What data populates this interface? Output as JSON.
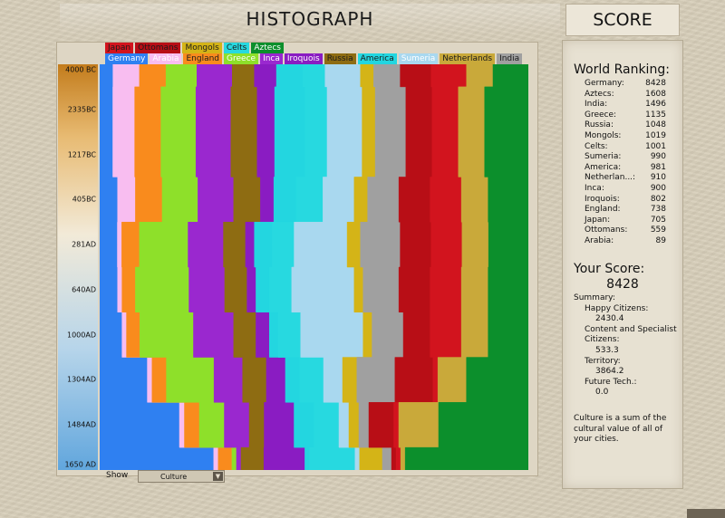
{
  "header": {
    "title": "HISTOGRAPH",
    "score_tab": "SCORE"
  },
  "legend": {
    "row1": [
      {
        "label": "Japan",
        "color": "#d2141e",
        "text": "#1b1b1b"
      },
      {
        "label": "Ottomans",
        "color": "#b80e16",
        "text": "#1b1b1b"
      },
      {
        "label": "Mongols",
        "color": "#d4b417",
        "text": "#1b1b1b"
      },
      {
        "label": "Celts",
        "color": "#27d9e0",
        "text": "#1b1b1b"
      },
      {
        "label": "Aztecs",
        "color": "#0c8f2c",
        "text": "#ffffff"
      }
    ],
    "row2": [
      {
        "label": "Germany",
        "color": "#2f80f1",
        "text": "#ffffff"
      },
      {
        "label": "Arabia",
        "color": "#f8bdf0",
        "text": "#ffffff"
      },
      {
        "label": "England",
        "color": "#f98b1d",
        "text": "#1b1b1b"
      },
      {
        "label": "Greece",
        "color": "#8ee02a",
        "text": "#ffffff"
      },
      {
        "label": "Inca",
        "color": "#9a28cf",
        "text": "#ffffff"
      },
      {
        "label": "Iroquois",
        "color": "#8a1cc2",
        "text": "#ffffff"
      },
      {
        "label": "Russia",
        "color": "#8e6c12",
        "text": "#1b1b1b"
      },
      {
        "label": "America",
        "color": "#23d6e0",
        "text": "#1b1b1b"
      },
      {
        "label": "Sumeria",
        "color": "#a9d8ef",
        "text": "#ffffff"
      },
      {
        "label": "Netherlands",
        "color": "#c9a93a",
        "text": "#1b1b1b"
      },
      {
        "label": "India",
        "color": "#a0a0a0",
        "text": "#1b1b1b"
      }
    ]
  },
  "y_axis_ticks": [
    "4000 BC",
    "2335BC",
    "1217BC",
    "405BC",
    "281AD",
    "640AD",
    "1000AD",
    "1304AD",
    "1484AD",
    "1650 AD"
  ],
  "chart_data": {
    "type": "area",
    "stacked": true,
    "normalized": true,
    "x": [
      "4000 BC",
      "2335BC",
      "1217BC",
      "405BC",
      "281AD",
      "640AD",
      "1000AD",
      "1304AD",
      "1484AD",
      "1650 AD"
    ],
    "series": [
      {
        "name": "Germany",
        "color": "#2f80f1",
        "values": [
          3,
          3,
          3,
          4,
          4,
          4,
          5,
          10,
          16,
          25
        ]
      },
      {
        "name": "Arabia",
        "color": "#f8bdf0",
        "values": [
          6,
          5,
          5,
          4,
          1,
          1,
          1,
          1,
          1,
          1
        ]
      },
      {
        "name": "England",
        "color": "#f98b1d",
        "values": [
          6,
          6,
          6,
          6,
          4,
          3,
          3,
          3,
          3,
          3
        ]
      },
      {
        "name": "Greece",
        "color": "#8ee02a",
        "values": [
          7,
          8,
          8,
          8,
          11,
          12,
          12,
          10,
          5,
          1
        ]
      },
      {
        "name": "Inca",
        "color": "#9a28cf",
        "values": [
          8,
          8,
          8,
          8,
          8,
          8,
          9,
          6,
          5,
          1
        ]
      },
      {
        "name": "Russia",
        "color": "#8e6c12",
        "values": [
          5,
          6,
          6,
          6,
          5,
          5,
          5,
          5,
          3,
          5
        ]
      },
      {
        "name": "Iroquois",
        "color": "#8a1cc2",
        "values": [
          5,
          4,
          4,
          3,
          2,
          2,
          3,
          4,
          6,
          9
        ]
      },
      {
        "name": "America",
        "color": "#23d6e0",
        "values": [
          6,
          7,
          7,
          5,
          4,
          3,
          2,
          3,
          4,
          1
        ]
      },
      {
        "name": "Celts",
        "color": "#27d9e0",
        "values": [
          5,
          5,
          5,
          6,
          5,
          5,
          5,
          5,
          5,
          10
        ]
      },
      {
        "name": "Sumeria",
        "color": "#a9d8ef",
        "values": [
          8,
          8,
          8,
          7,
          12,
          14,
          14,
          4,
          2,
          1
        ]
      },
      {
        "name": "Mongols",
        "color": "#d4b417",
        "values": [
          3,
          3,
          3,
          3,
          3,
          2,
          2,
          3,
          2,
          5
        ]
      },
      {
        "name": "India",
        "color": "#a0a0a0",
        "values": [
          6,
          7,
          7,
          7,
          9,
          8,
          7,
          8,
          2,
          2
        ]
      },
      {
        "name": "Ottomans",
        "color": "#b80e16",
        "values": [
          7,
          6,
          6,
          7,
          7,
          7,
          6,
          8,
          5,
          1
        ]
      },
      {
        "name": "Japan",
        "color": "#d2141e",
        "values": [
          8,
          6,
          6,
          7,
          7,
          7,
          7,
          1,
          1,
          1
        ]
      },
      {
        "name": "Netherlands",
        "color": "#c9a93a",
        "values": [
          6,
          6,
          6,
          6,
          6,
          6,
          6,
          6,
          8,
          1
        ]
      },
      {
        "name": "Aztecs",
        "color": "#0c8f2c",
        "values": [
          8,
          10,
          10,
          9,
          9,
          9,
          9,
          13,
          18,
          27
        ]
      }
    ],
    "ylabel": "",
    "xlabel": ""
  },
  "show": {
    "label": "Show",
    "value": "Culture"
  },
  "score_panel": {
    "world_ranking_title": "World Ranking:",
    "rankings": [
      {
        "name": "Germany:",
        "score": "8428"
      },
      {
        "name": "Aztecs:",
        "score": "1608"
      },
      {
        "name": "India:",
        "score": "1496"
      },
      {
        "name": "Greece:",
        "score": "1135"
      },
      {
        "name": "Russia:",
        "score": "1048"
      },
      {
        "name": "Mongols:",
        "score": "1019"
      },
      {
        "name": "Celts:",
        "score": "1001"
      },
      {
        "name": "Sumeria:",
        "score": "990"
      },
      {
        "name": "America:",
        "score": "981"
      },
      {
        "name": "Netherlan...:",
        "score": "910"
      },
      {
        "name": "Inca:",
        "score": "900"
      },
      {
        "name": "Iroquois:",
        "score": "802"
      },
      {
        "name": "England:",
        "score": "738"
      },
      {
        "name": "Japan:",
        "score": "705"
      },
      {
        "name": "Ottomans:",
        "score": "559"
      },
      {
        "name": "Arabia:",
        "score": "89"
      }
    ],
    "your_score_title": "Your Score:",
    "your_score_value": "8428",
    "summary_title": "Summary:",
    "summary_items": [
      {
        "label": "Happy Citizens:",
        "value": "2430.4"
      },
      {
        "label": "Content and Specialist Citizens:",
        "value": "533.3"
      },
      {
        "label": "Territory:",
        "value": "3864.2"
      },
      {
        "label": "Future Tech.:",
        "value": "0.0"
      }
    ],
    "footnote": "Culture is a sum of the cultural value of all of your cities."
  }
}
